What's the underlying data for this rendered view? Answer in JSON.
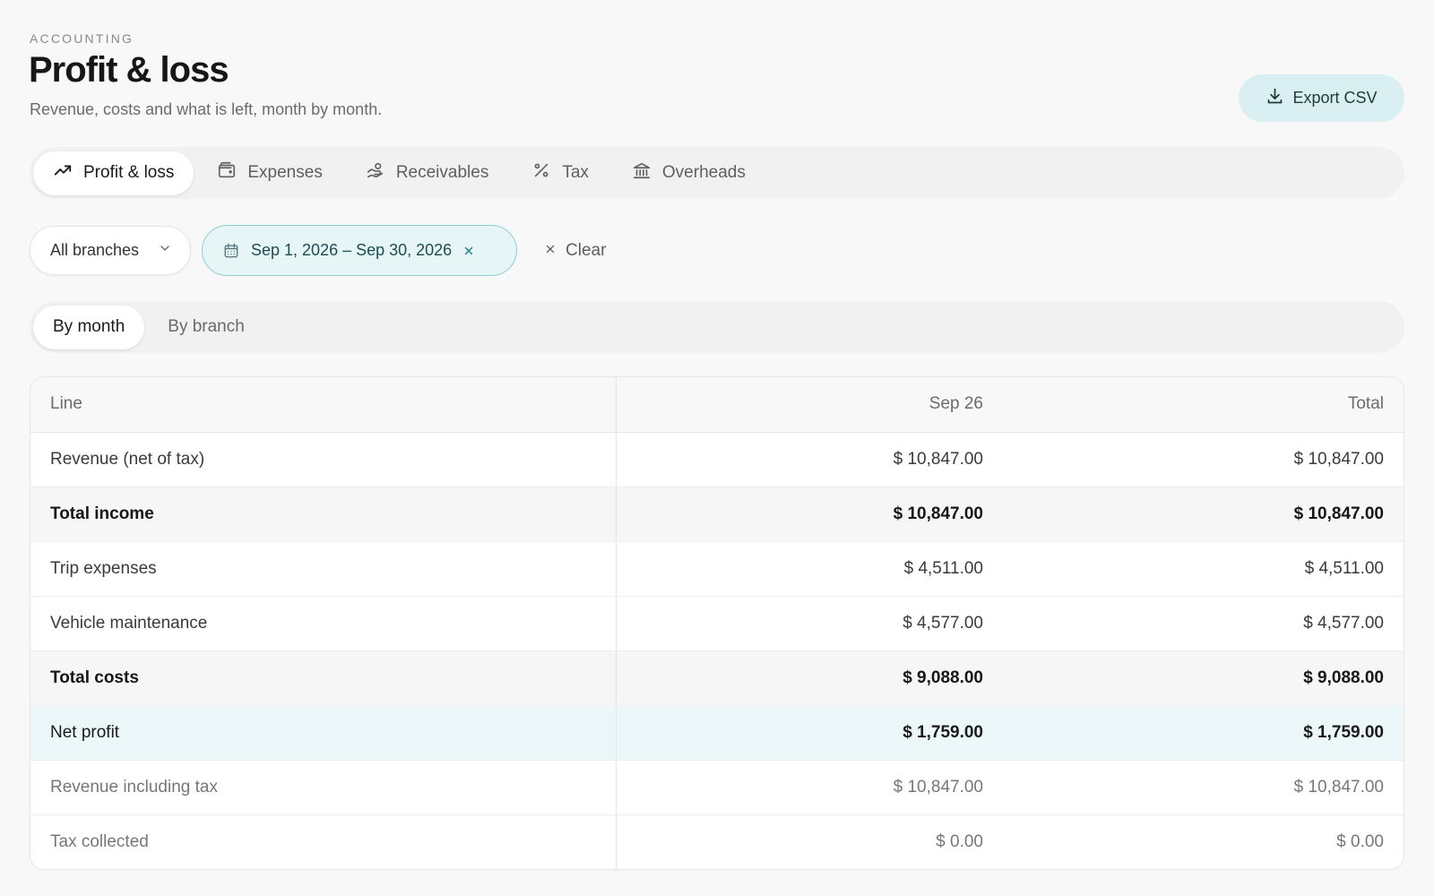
{
  "header": {
    "eyebrow": "ACCOUNTING",
    "title": "Profit & loss",
    "subtitle": "Revenue, costs and what is left, month by month.",
    "export_label": "Export CSV"
  },
  "tabs": [
    {
      "label": "Profit & loss",
      "icon": "trending-up-icon",
      "active": true
    },
    {
      "label": "Expenses",
      "icon": "wallet-icon",
      "active": false
    },
    {
      "label": "Receivables",
      "icon": "hand-coins-icon",
      "active": false
    },
    {
      "label": "Tax",
      "icon": "percent-icon",
      "active": false
    },
    {
      "label": "Overheads",
      "icon": "bank-icon",
      "active": false
    }
  ],
  "filters": {
    "branch_value": "All branches",
    "date_range": "Sep 1, 2026 – Sep 30, 2026",
    "clear_label": "Clear"
  },
  "view_toggle": {
    "by_month": "By month",
    "by_branch": "By branch",
    "selected": "By month"
  },
  "table": {
    "headers": [
      "Line",
      "Sep 26",
      "Total"
    ],
    "rows": [
      {
        "line": "Revenue (net of tax)",
        "sep26": "$ 10,847.00",
        "total": "$ 10,847.00",
        "style": "normal"
      },
      {
        "line": "Total income",
        "sep26": "$ 10,847.00",
        "total": "$ 10,847.00",
        "style": "bold"
      },
      {
        "line": "Trip expenses",
        "sep26": "$ 4,511.00",
        "total": "$ 4,511.00",
        "style": "normal"
      },
      {
        "line": "Vehicle maintenance",
        "sep26": "$ 4,577.00",
        "total": "$ 4,577.00",
        "style": "normal"
      },
      {
        "line": "Total costs",
        "sep26": "$ 9,088.00",
        "total": "$ 9,088.00",
        "style": "bold"
      },
      {
        "line": "Net profit",
        "sep26": "$ 1,759.00",
        "total": "$ 1,759.00",
        "style": "net"
      },
      {
        "line": "Revenue including tax",
        "sep26": "$ 10,847.00",
        "total": "$ 10,847.00",
        "style": "muted"
      },
      {
        "line": "Tax collected",
        "sep26": "$ 0.00",
        "total": "$ 0.00",
        "style": "muted"
      }
    ]
  },
  "colors": {
    "accent": "#d9eff1",
    "chip_border": "#8ccfd4",
    "net_row": "#ebf7f8"
  }
}
